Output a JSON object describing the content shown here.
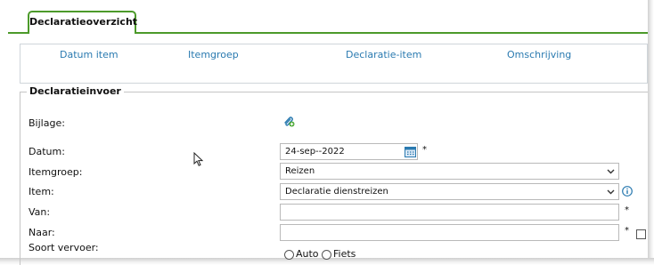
{
  "tab": {
    "label": "Declaratieoverzicht"
  },
  "overview": {
    "headers": [
      "Datum item",
      "Itemgroep",
      "Declaratie-item",
      "Omschrijving"
    ]
  },
  "form": {
    "legend": "Declaratieinvoer",
    "bijlage_label": "Bijlage:",
    "datum_label": "Datum:",
    "datum_value": "24-sep--2022",
    "itemgroep_label": "Itemgroep:",
    "itemgroep_value": "Reizen",
    "item_label": "Item:",
    "item_value": "Declaratie dienstreizen",
    "van_label": "Van:",
    "naar_label": "Naar:",
    "soort_vervoer_label": "Soort vervoer:",
    "vervoer_options": [
      "Auto",
      "Fiets"
    ],
    "required_marker": "*"
  },
  "colors": {
    "accent_green": "#4c9a2a",
    "header_blue": "#2a7ab0"
  },
  "icons": {
    "attach": "paperclip-add-icon",
    "calendar": "calendar-icon",
    "info": "info-icon",
    "dropdown": "chevron-down-icon",
    "pointer": "mouse-pointer-icon"
  }
}
